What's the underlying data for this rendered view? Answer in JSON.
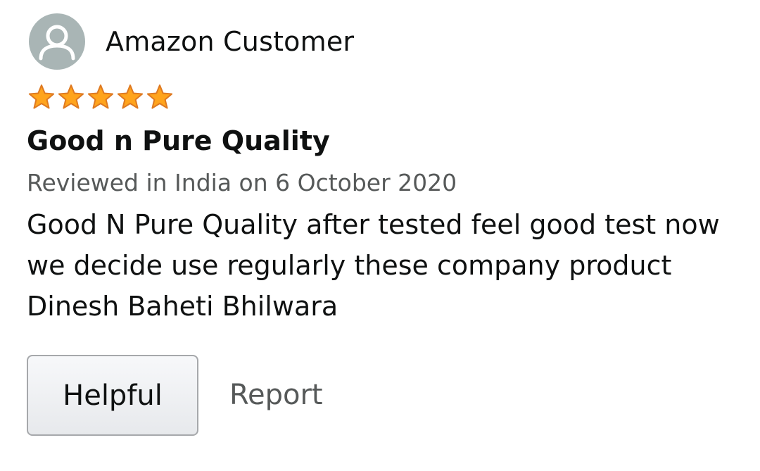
{
  "review": {
    "author": "Amazon Customer",
    "avatar_icon": "user-silhouette-icon",
    "rating": 5,
    "rating_max": 5,
    "star_color": "#ffa41c",
    "title": "Good n Pure Quality",
    "meta": "Reviewed in India on 6 October 2020",
    "body": "Good N Pure Quality after tested feel good test now we decide use regularly these company product Dinesh Baheti Bhilwara"
  },
  "actions": {
    "helpful_label": "Helpful",
    "report_label": "Report"
  }
}
